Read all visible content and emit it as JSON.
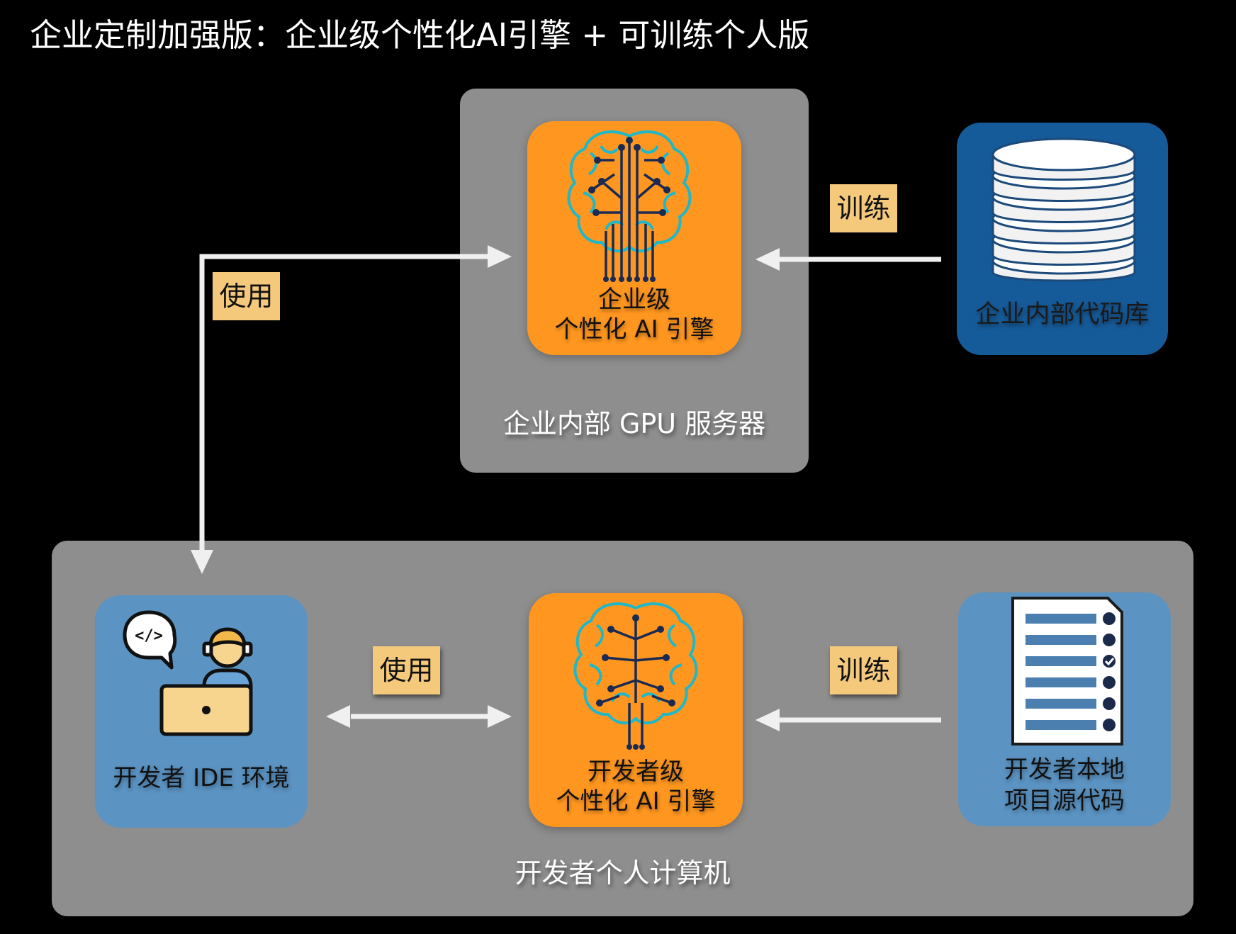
{
  "title": "企业定制加强版：企业级个性化AI引擎 + 可训练个人版",
  "server": {
    "caption": "企业内部 GPU 服务器",
    "engine_line1": "企业级",
    "engine_line2": "个性化 AI 引擎"
  },
  "repo": {
    "label": "企业内部代码库",
    "icon": "database-icon"
  },
  "pc": {
    "caption": "开发者个人计算机",
    "engine_line1": "开发者级",
    "engine_line2": "个性化 AI 引擎",
    "ide_label": "开发者 IDE 环境",
    "ide_icon": "developer-laptop-icon",
    "src_line1": "开发者本地",
    "src_line2": "项目源代码",
    "src_icon": "document-checklist-icon"
  },
  "tags": {
    "train_top": "训练",
    "use_left": "使用",
    "use_mid": "使用",
    "train_bottom": "训练"
  },
  "colors": {
    "background": "#000000",
    "panel": "#8e8e8e",
    "engine": "#ff961f",
    "repo": "#165b99",
    "local": "#5b93c2",
    "tag": "#f5c97c",
    "arrow": "#f0f0f0",
    "brain": "#1fb8c8"
  }
}
